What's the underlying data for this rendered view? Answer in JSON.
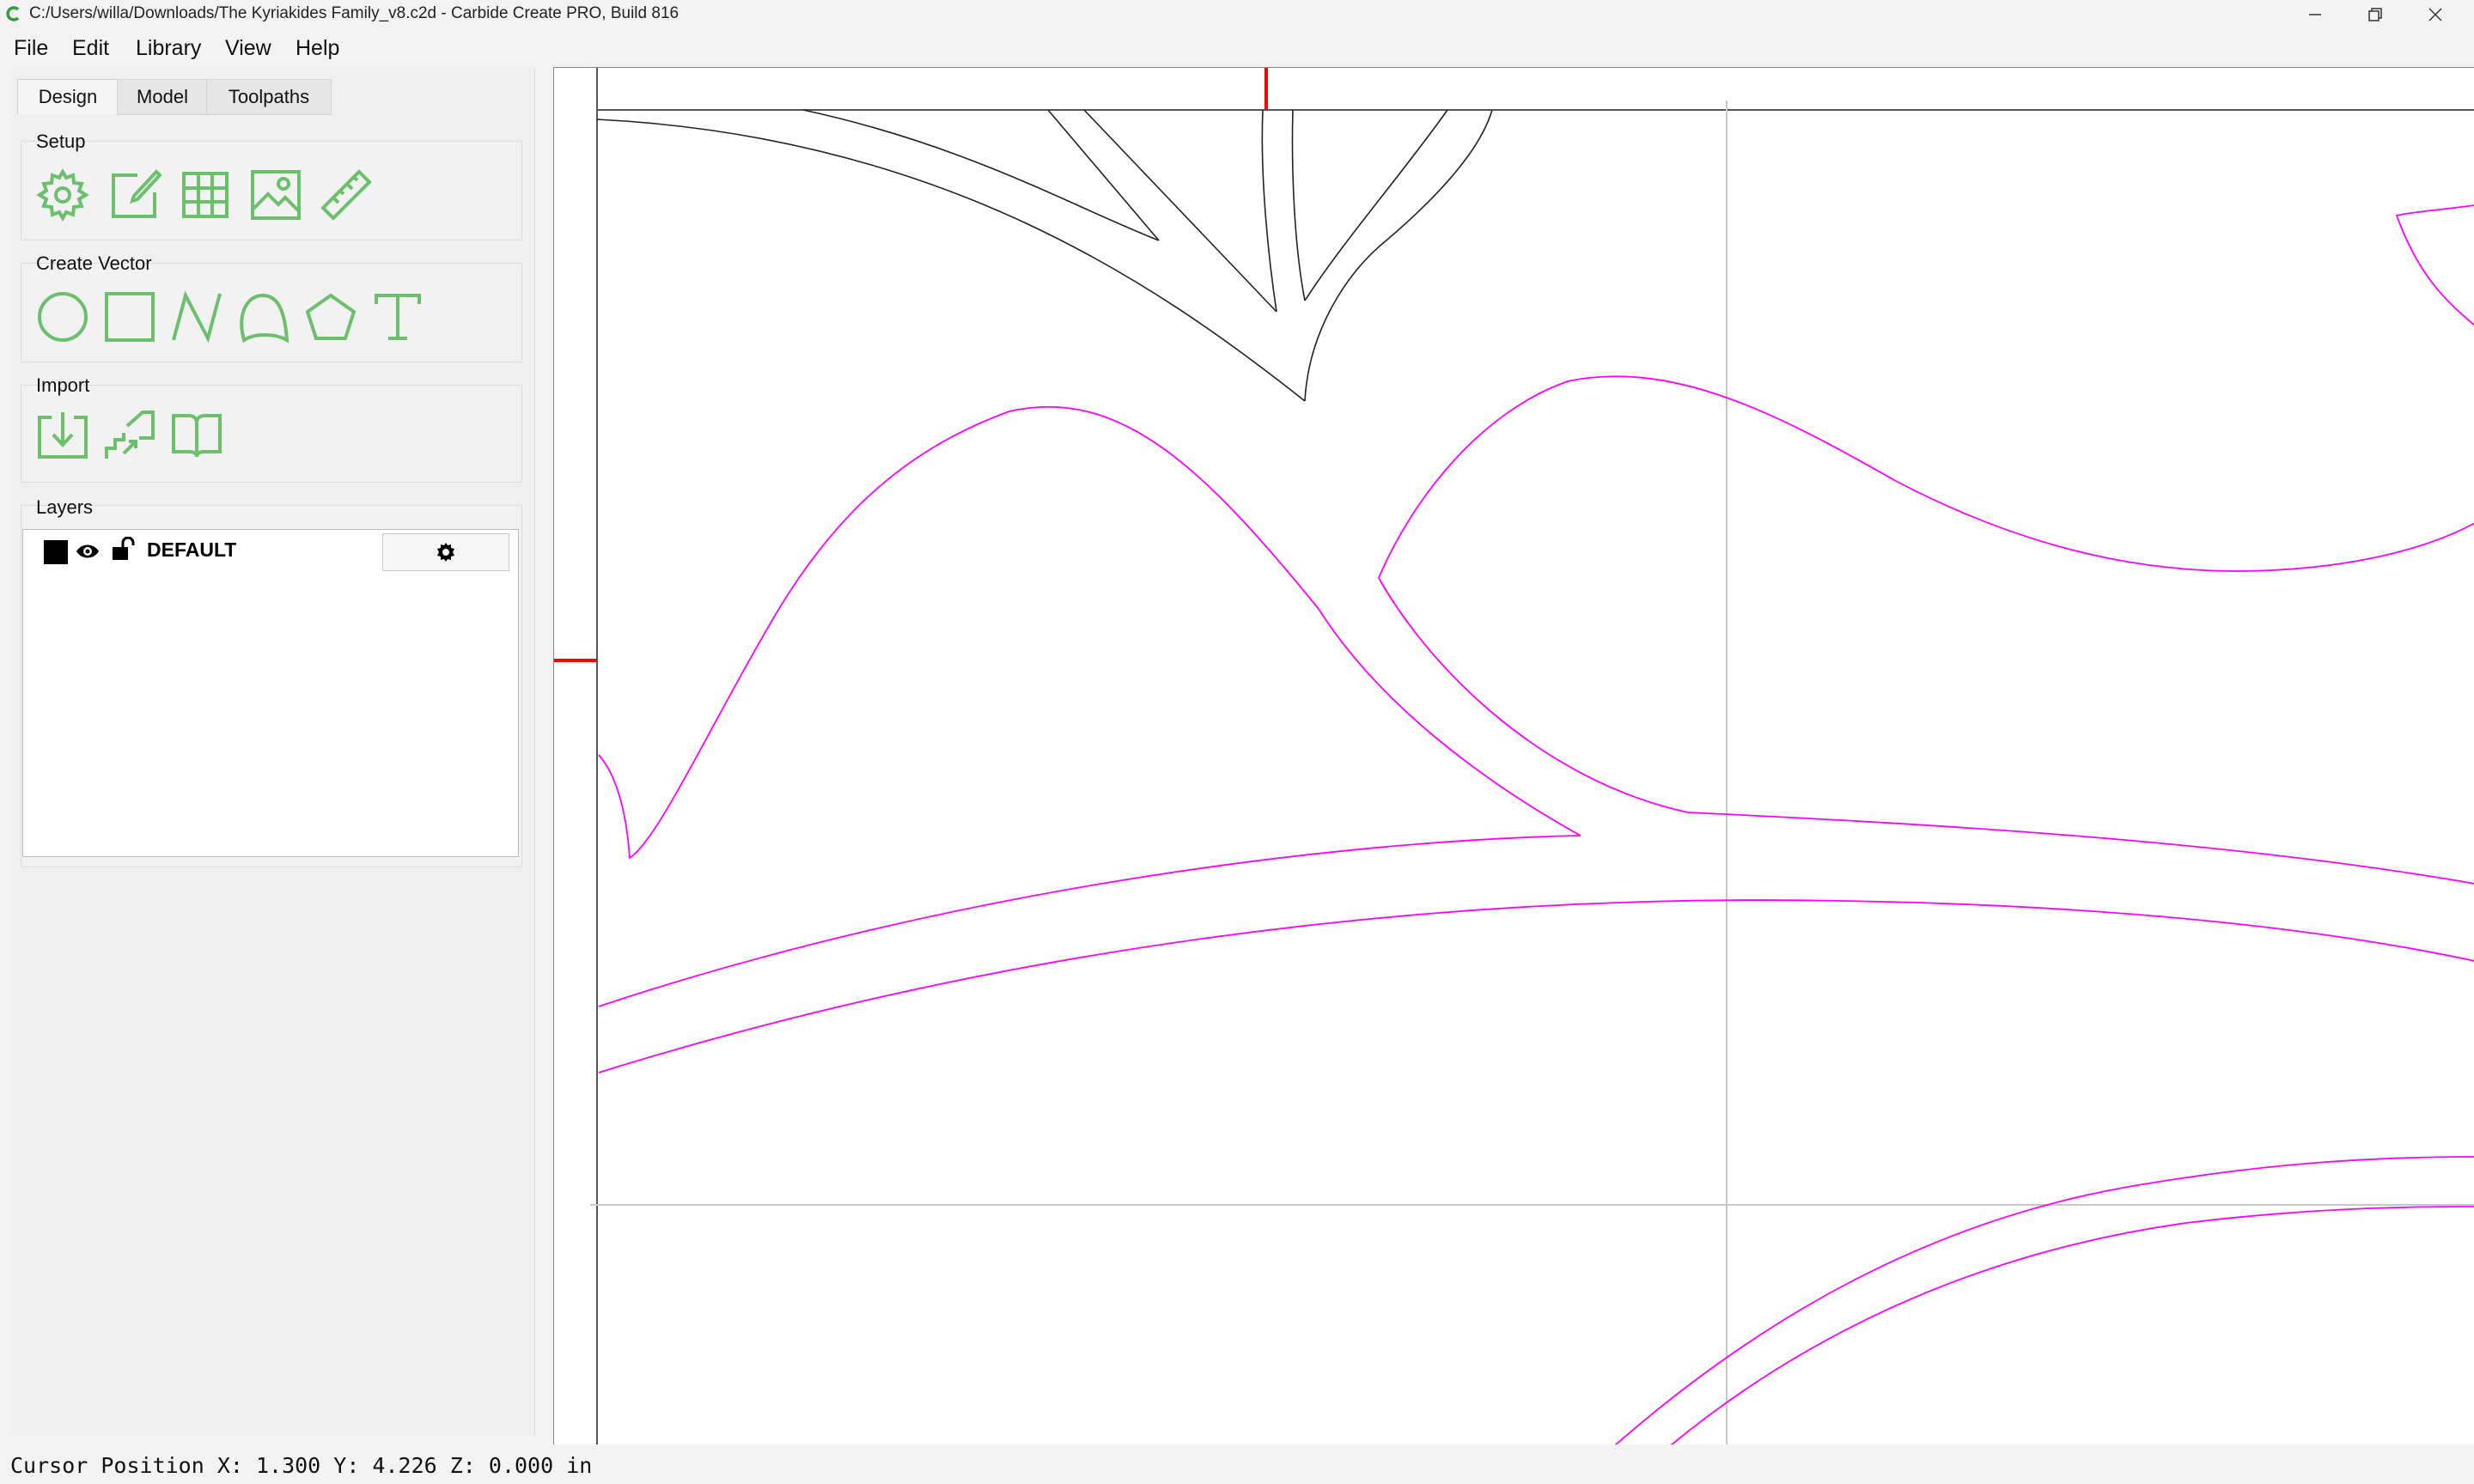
{
  "window": {
    "title": "C:/Users/willa/Downloads/The Kyriakides Family_v8.c2d - Carbide Create PRO, Build 816",
    "minimize_icon": "minimize-icon",
    "restore_icon": "restore-icon",
    "close_icon": "close-icon"
  },
  "menu": {
    "items": [
      "File",
      "Edit",
      "Library",
      "View",
      "Help"
    ]
  },
  "tabs": [
    {
      "label": "Design",
      "active": true
    },
    {
      "label": "Model",
      "active": false
    },
    {
      "label": "Toolpaths",
      "active": false
    }
  ],
  "groups": {
    "setup": {
      "label": "Setup",
      "icons": [
        "settings-gear-icon",
        "edit-document-icon",
        "grid-icon",
        "image-icon",
        "ruler-icon"
      ]
    },
    "create_vector": {
      "label": "Create Vector",
      "icons": [
        "circle-icon",
        "rectangle-icon",
        "polyline-icon",
        "curve-icon",
        "polygon-icon",
        "text-icon"
      ]
    },
    "import": {
      "label": "Import",
      "icons": [
        "import-icon",
        "import-steps-icon",
        "library-book-icon"
      ]
    },
    "layers": {
      "label": "Layers",
      "items": [
        {
          "name": "DEFAULT",
          "color": "#000000",
          "visible": true,
          "locked": false
        }
      ]
    }
  },
  "colors": {
    "accent_icon": "#6cbf6c",
    "vector_magenta": "#ff00ff",
    "vector_black": "#222222",
    "marker_red": "#ff0000"
  },
  "status": {
    "text": "Cursor Position X: 1.300 Y: 4.226 Z: 0.000 in"
  }
}
